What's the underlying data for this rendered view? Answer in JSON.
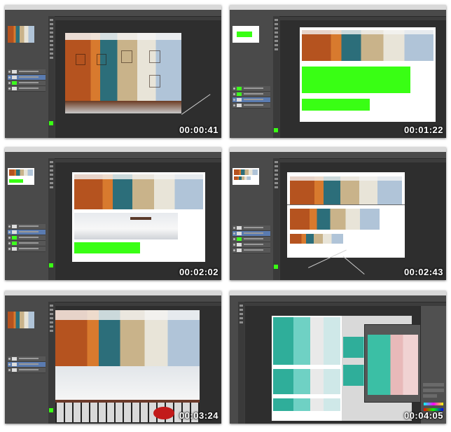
{
  "thumbnails": [
    {
      "time": "00:00:41"
    },
    {
      "time": "00:01:22"
    },
    {
      "time": "00:02:02"
    },
    {
      "time": "00:02:43"
    },
    {
      "time": "00:03:24"
    },
    {
      "time": "00:04:05"
    }
  ],
  "colors": {
    "accent_green": "#39ff14",
    "panel": "#4a4a4a",
    "canvas": "#2e2e2e"
  }
}
